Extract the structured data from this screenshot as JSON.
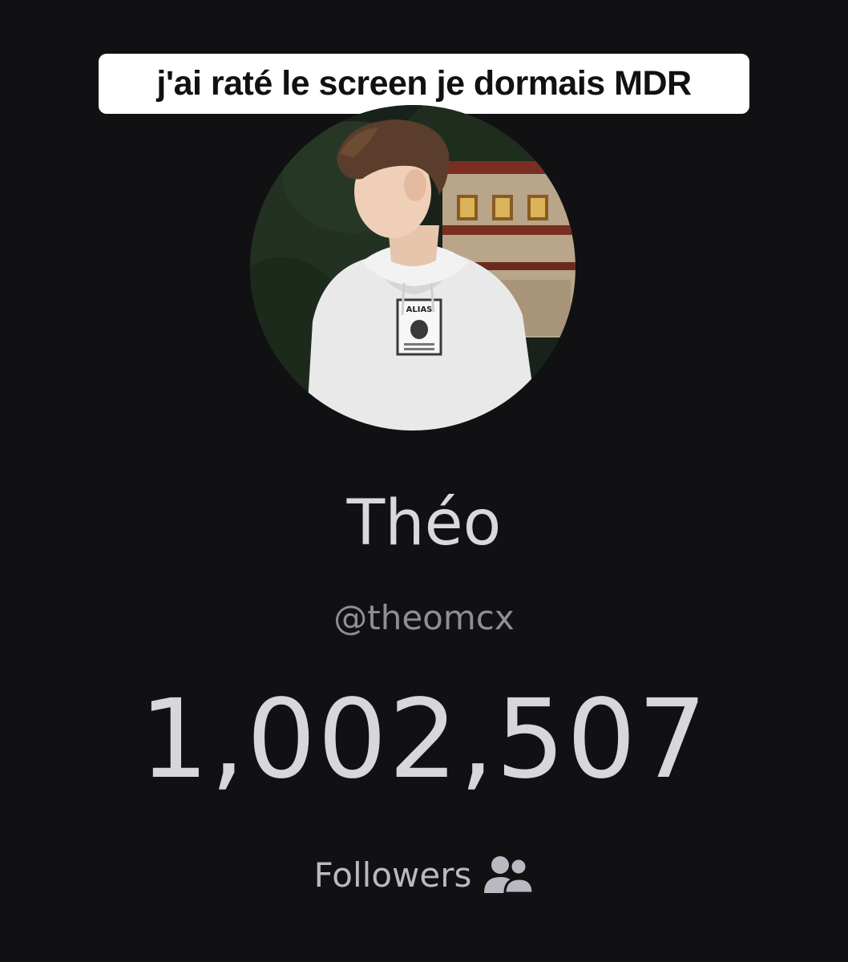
{
  "caption": {
    "text": "j'ai raté le screen je dormais MDR"
  },
  "profile": {
    "name": "Théo",
    "handle": "@theomcx",
    "avatar_icon": "profile-photo",
    "hoodie_print": "ALIAS"
  },
  "stats": {
    "followers_count": "1,002,507",
    "followers_label": "Followers",
    "followers_icon": "users-icon"
  },
  "colors": {
    "background": "#111113",
    "caption_bg": "#ffffff",
    "text_primary": "#d8d8de",
    "text_secondary": "#8e8e96"
  }
}
